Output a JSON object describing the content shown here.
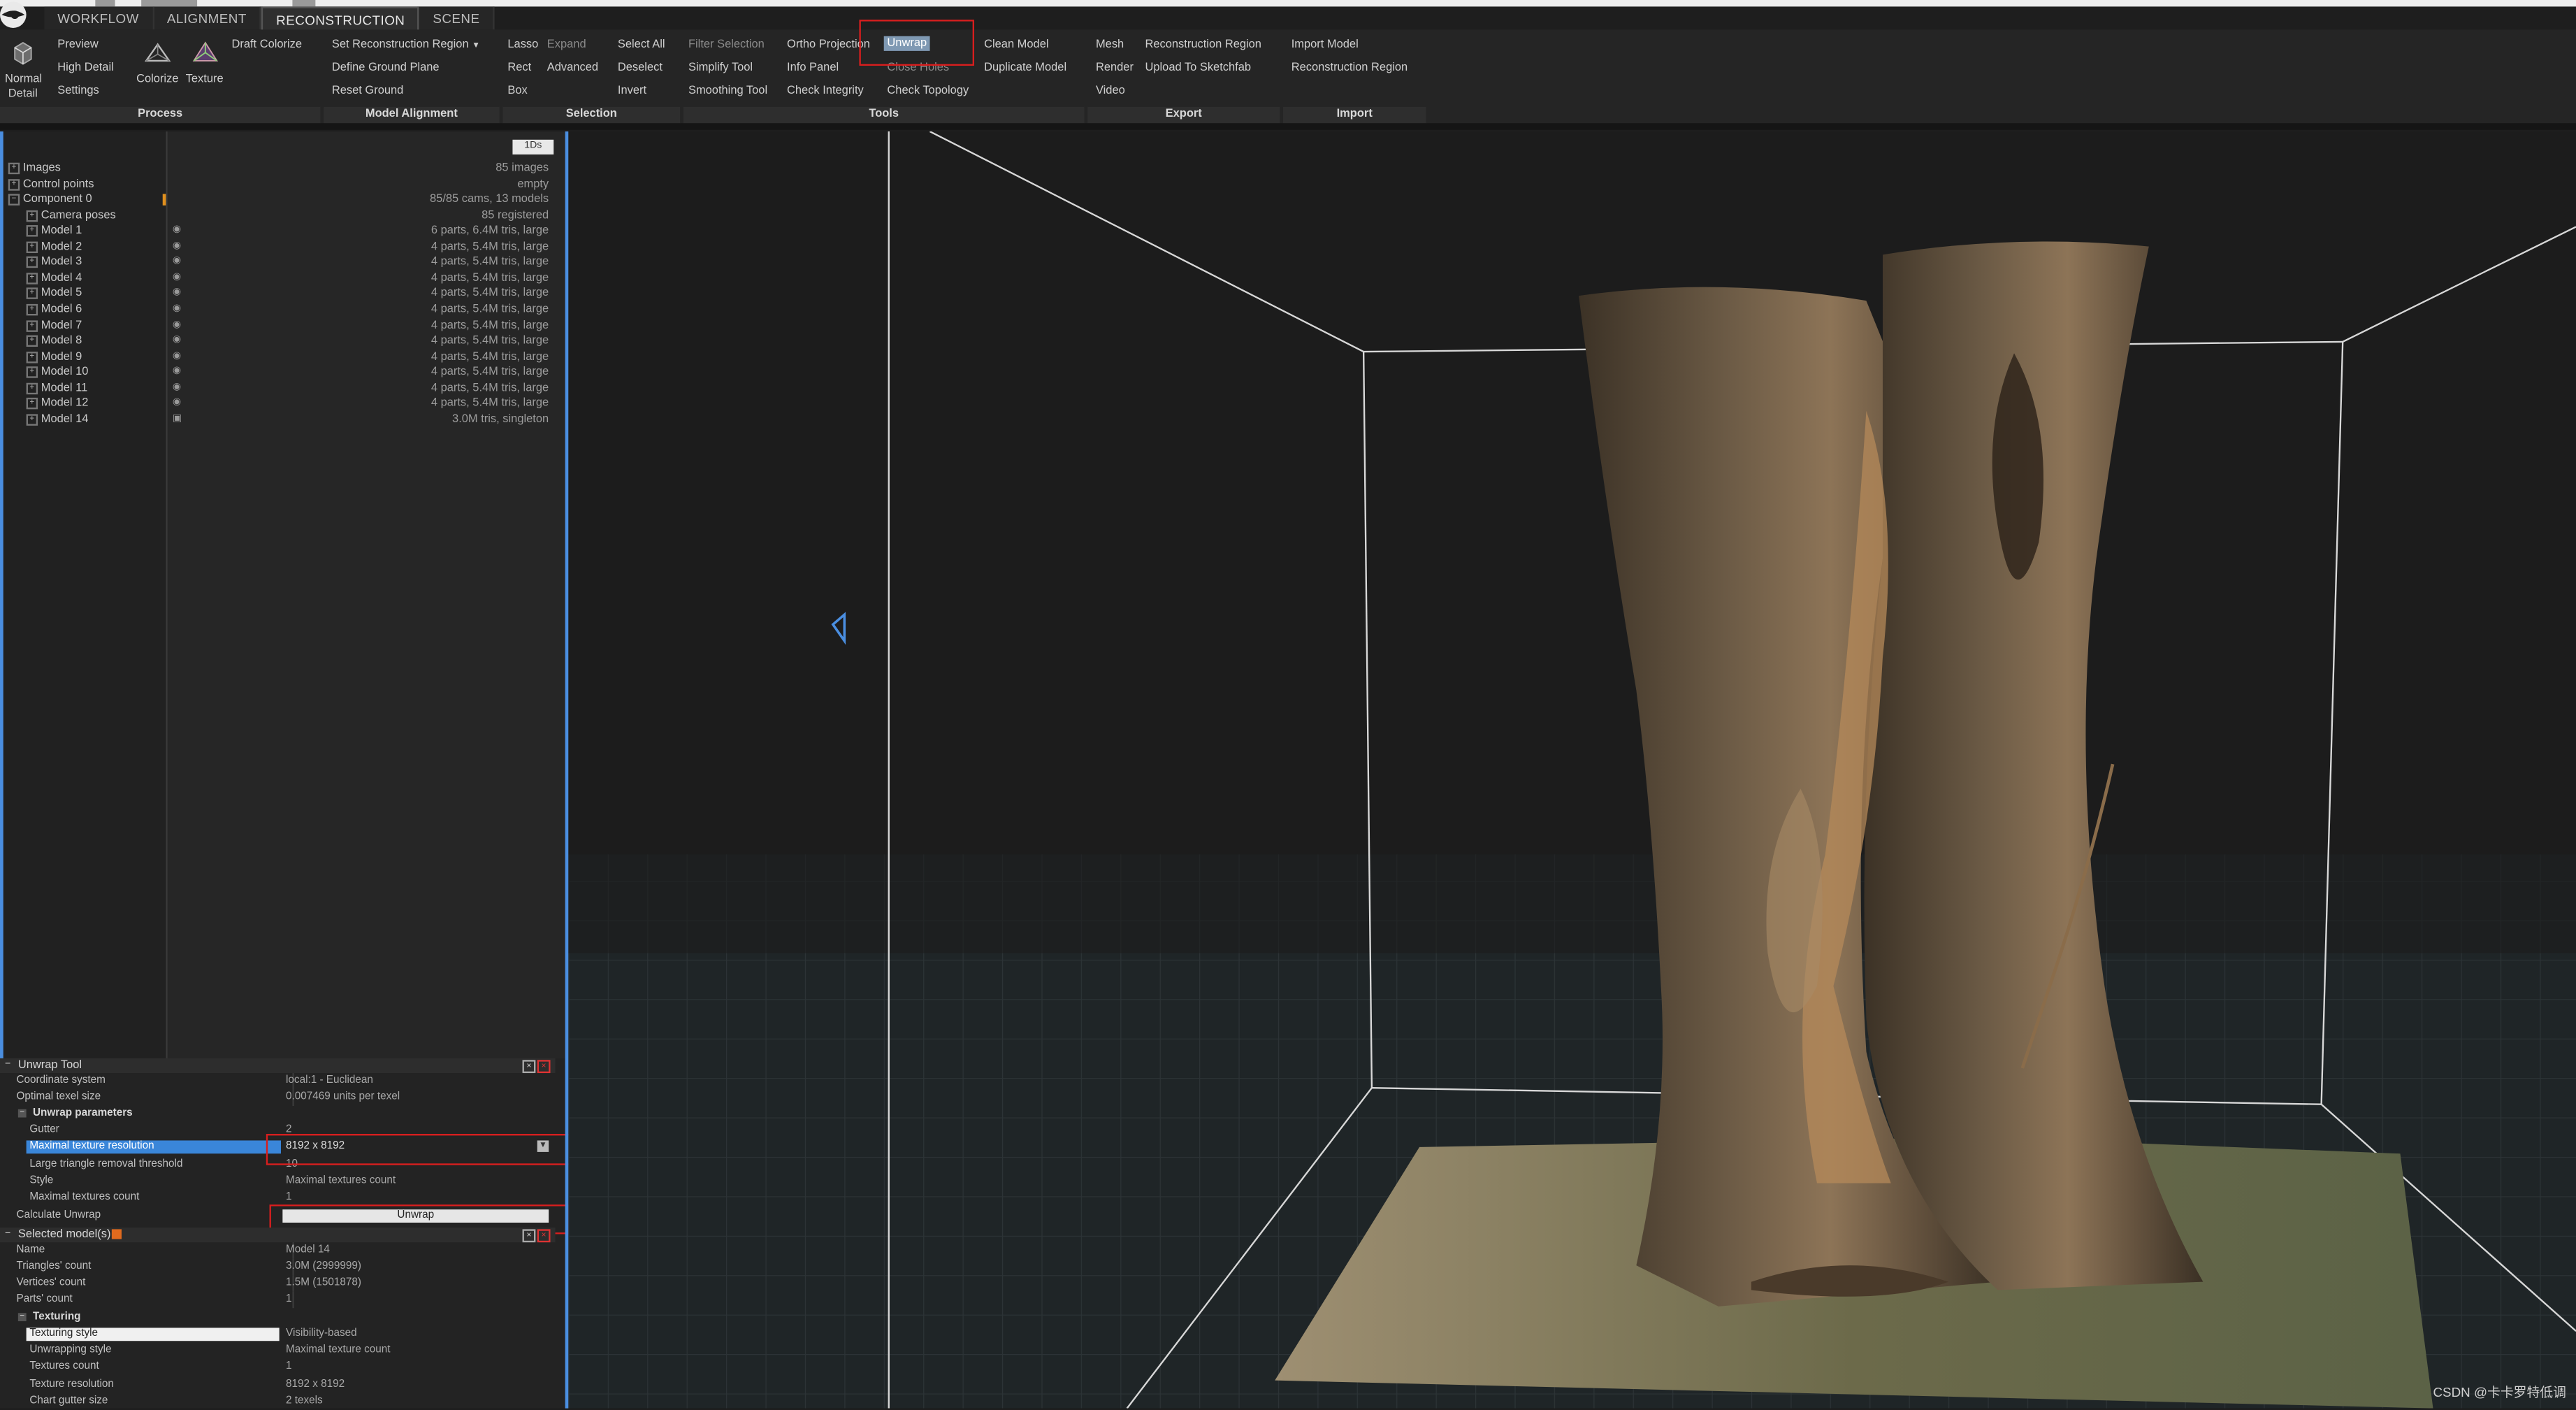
{
  "tabs": [
    "WORKFLOW",
    "ALIGNMENT",
    "RECONSTRUCTION",
    "SCENE"
  ],
  "active_tab": "RECONSTRUCTION",
  "ribbon": {
    "process": {
      "label": "Process",
      "normal_detail_line1": "Normal",
      "normal_detail_line2": "Detail",
      "preview": "Preview",
      "high_detail": "High Detail",
      "settings": "Settings",
      "colorize": "Colorize",
      "texture": "Texture",
      "draft_colorize": "Draft Colorize"
    },
    "model_alignment": {
      "label": "Model Alignment",
      "set_reconstruction_region": "Set Reconstruction Region",
      "define_ground_plane": "Define Ground Plane",
      "reset_ground": "Reset Ground"
    },
    "selection": {
      "label": "Selection",
      "lasso": "Lasso",
      "expand": "Expand",
      "rect": "Rect",
      "advanced": "Advanced",
      "box": "Box",
      "select_all": "Select All",
      "deselect": "Deselect",
      "invert": "Invert"
    },
    "tools": {
      "label": "Tools",
      "filter_selection": "Filter Selection",
      "simplify_tool": "Simplify Tool",
      "smoothing_tool": "Smoothing Tool",
      "ortho_projection": "Ortho Projection",
      "info_panel": "Info Panel",
      "check_integrity": "Check Integrity",
      "unwrap": "Unwrap",
      "close_holes": "Close Holes",
      "check_topology": "Check Topology",
      "clean_model": "Clean Model",
      "duplicate_model": "Duplicate Model"
    },
    "export": {
      "label": "Export",
      "mesh": "Mesh",
      "render": "Render",
      "video": "Video",
      "reconstruction_region": "Reconstruction Region",
      "upload_to_sketchfab": "Upload To Sketchfab"
    },
    "import": {
      "label": "Import",
      "import_model": "Import Model",
      "reconstruction_region": "Reconstruction Region"
    }
  },
  "tree": {
    "oneds_button": "1Ds",
    "items": [
      {
        "name": "Images",
        "value": "85 images"
      },
      {
        "name": "Control points",
        "value": "empty"
      },
      {
        "name": "Component 0",
        "value": "85/85 cams, 13 models"
      },
      {
        "name": "Camera poses",
        "value": "85 registered"
      },
      {
        "name": "Model 1",
        "value": "6 parts, 6.4M tris, large"
      },
      {
        "name": "Model 2",
        "value": "4 parts, 5.4M tris, large"
      },
      {
        "name": "Model 3",
        "value": "4 parts, 5.4M tris, large"
      },
      {
        "name": "Model 4",
        "value": "4 parts, 5.4M tris, large"
      },
      {
        "name": "Model 5",
        "value": "4 parts, 5.4M tris, large"
      },
      {
        "name": "Model 6",
        "value": "4 parts, 5.4M tris, large"
      },
      {
        "name": "Model 7",
        "value": "4 parts, 5.4M tris, large"
      },
      {
        "name": "Model 8",
        "value": "4 parts, 5.4M tris, large"
      },
      {
        "name": "Model 9",
        "value": "4 parts, 5.4M tris, large"
      },
      {
        "name": "Model 10",
        "value": "4 parts, 5.4M tris, large"
      },
      {
        "name": "Model 11",
        "value": "4 parts, 5.4M tris, large"
      },
      {
        "name": "Model 12",
        "value": "4 parts, 5.4M tris, large"
      },
      {
        "name": "Model 14",
        "value": "3.0M tris, singleton"
      }
    ]
  },
  "unwrap_tool": {
    "title": "Unwrap Tool",
    "rows": [
      {
        "key": "Coordinate system",
        "value": "local:1 - Euclidean"
      },
      {
        "key": "Optimal texel size",
        "value": "0.007469 units per texel"
      }
    ],
    "section": "Unwrap parameters",
    "params": [
      {
        "key": "Gutter",
        "value": "2"
      },
      {
        "key": "Maximal texture resolution",
        "value": "8192 x 8192"
      },
      {
        "key": "Large triangle removal threshold",
        "value": "10"
      },
      {
        "key": "Style",
        "value": "Maximal textures count"
      },
      {
        "key": "Maximal textures count",
        "value": "1"
      }
    ],
    "calculate_label": "Calculate Unwrap",
    "unwrap_button": "Unwrap"
  },
  "selected_models": {
    "title": "Selected model(s)",
    "rows": [
      {
        "key": "Name",
        "value": "Model 14"
      },
      {
        "key": "Triangles' count",
        "value": "3.0M (2999999)"
      },
      {
        "key": "Vertices' count",
        "value": "1.5M (1501878)"
      },
      {
        "key": "Parts' count",
        "value": "1"
      }
    ],
    "section": "Texturing",
    "tex_rows": [
      {
        "key": "Texturing style",
        "value": "Visibility-based"
      },
      {
        "key": "Unwrapping style",
        "value": "Maximal texture count"
      },
      {
        "key": "Textures count",
        "value": "1"
      },
      {
        "key": "Texture resolution",
        "value": "8192 x 8192"
      },
      {
        "key": "Chart gutter size",
        "value": "2 texels"
      }
    ]
  },
  "watermark": "CSDN @卡卡罗特低调",
  "colors": {
    "accent": "#4a8ee0",
    "highlight": "#d81e1e",
    "selected_row": "#3a86d9"
  }
}
